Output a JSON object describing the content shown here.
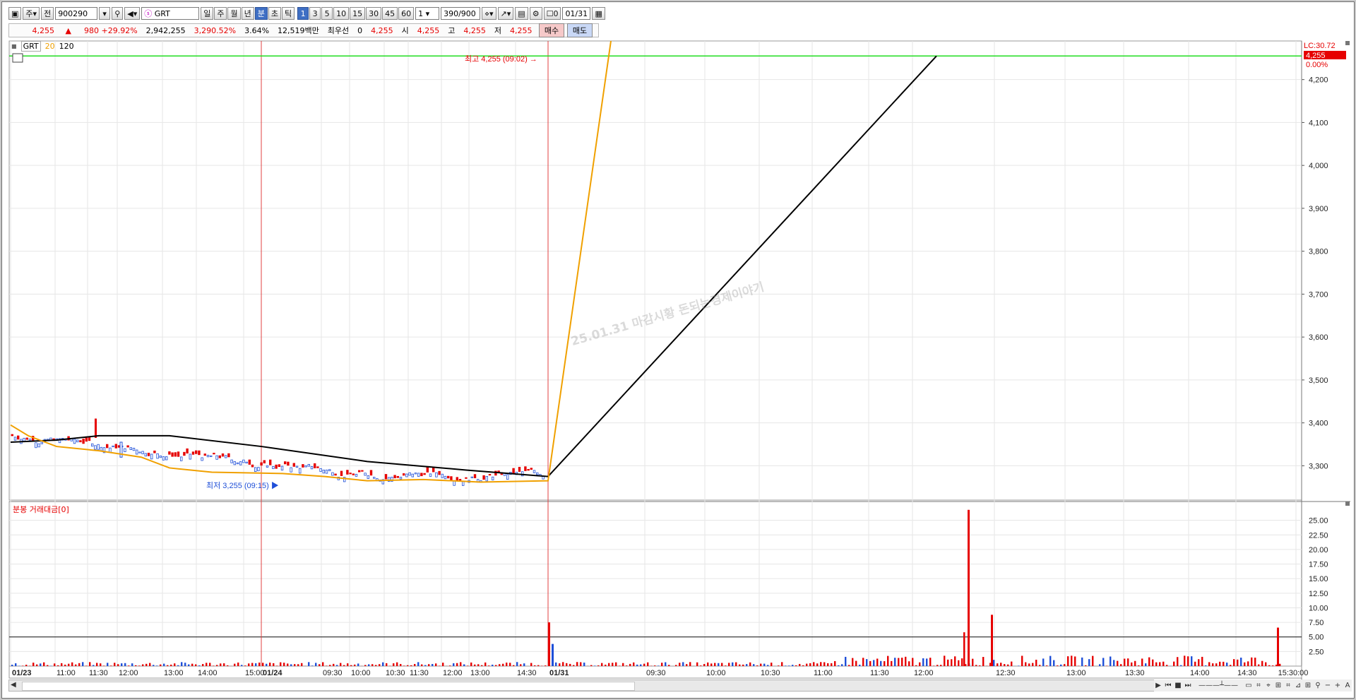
{
  "toolbar": {
    "market": "주",
    "full": "전",
    "code": "900290",
    "name": "GRT",
    "periods": [
      "일",
      "주",
      "월",
      "년",
      "분",
      "초",
      "틱"
    ],
    "selected_period": "분",
    "minutes": [
      "1",
      "3",
      "5",
      "10",
      "15",
      "30",
      "45",
      "60"
    ],
    "selected_minute": "1",
    "count_value": "1",
    "range": "390/900",
    "check_label": "0",
    "date": "01/31"
  },
  "quote": {
    "price": "4,255",
    "change": "980 +29.92%",
    "volume": "2,942,255",
    "vol_ratio": "3,290.52%",
    "turnover": "3.64%",
    "amount": "12,519백만",
    "pref_label": "최우선",
    "pref_value": "0",
    "pref_price": "4,255",
    "open_label": "시",
    "open": "4,255",
    "high_label": "고",
    "high": "4,255",
    "low_label": "저",
    "low": "4,255",
    "buy": "매수",
    "sell": "매도"
  },
  "legend": {
    "name": "GRT",
    "ma_a": "20",
    "ma_b": "120"
  },
  "volume_panel_label": "분봉 거래대금[0]",
  "right_label": {
    "lc": "LC:30.72",
    "price": "4,255",
    "pct": "0.00%"
  },
  "watermark": "25.01.31 마감시황 돈되는경제이야기",
  "colors": {
    "up": "#e60000",
    "down": "#1f4fd8",
    "ma20": "#f0a000",
    "ma120": "#000000",
    "highline": "#22dd22"
  },
  "chart_data": [
    {
      "type": "candlestick",
      "title": "",
      "y_ticks": [
        "4,200",
        "4,100",
        "4,000",
        "3,900",
        "3,800",
        "3,700",
        "3,600",
        "3,500",
        "3,400",
        "3,300"
      ],
      "ylim": [
        3220,
        4290
      ],
      "x_labels": [
        "01/23",
        "11:00",
        "11:30",
        "12:00",
        "13:00",
        "14:00",
        "15:00",
        "01/24",
        "09:30",
        "10:00",
        "10:30",
        "11:30",
        "12:00",
        "13:00",
        "14:30",
        "01/31",
        "09:30",
        "10:00",
        "10:30",
        "11:00",
        "11:30",
        "12:00",
        "12:30",
        "13:00",
        "13:30",
        "14:00",
        "14:30",
        "15:30:00"
      ],
      "annotations": {
        "high": "최고 4,255 (09:02)",
        "low": "최저 3,255 (09:15)"
      },
      "horizontal_line": 4255,
      "prev_session_price_range": [
        3255,
        3410
      ],
      "last_price": 4255
    },
    {
      "type": "bar",
      "title": "분봉 거래대금[0]",
      "y_ticks": [
        "25.00",
        "22.50",
        "20.00",
        "17.50",
        "15.00",
        "12.50",
        "10.00",
        "7.50",
        "5.00",
        "2.50"
      ],
      "ylim": [
        0,
        27.5
      ],
      "reference_line": 5.0,
      "notable_bars": [
        7.5,
        3.8,
        26.8,
        8.8,
        6.6
      ]
    }
  ]
}
